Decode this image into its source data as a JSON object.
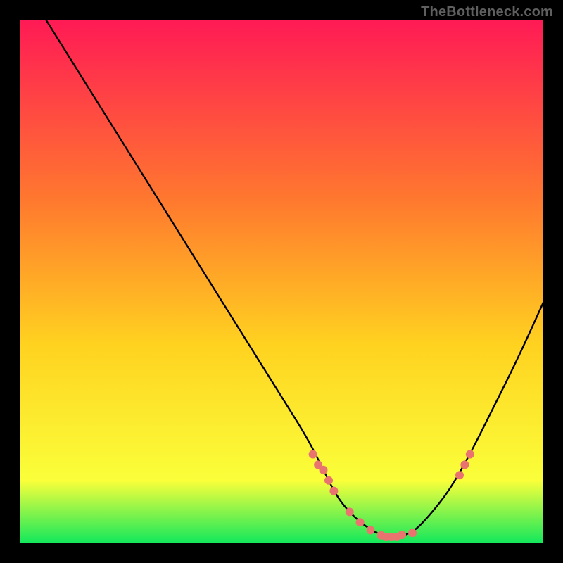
{
  "watermark": "TheBottleneck.com",
  "colors": {
    "gradient_top": "#ff1a55",
    "gradient_mid1": "#ff7a2e",
    "gradient_mid2": "#ffd220",
    "gradient_mid3": "#faff3a",
    "gradient_bottom": "#12e85c",
    "curve": "#000000",
    "marker": "#e9746f",
    "frame_bg": "#000000"
  },
  "chart_data": {
    "type": "line",
    "title": "",
    "xlabel": "",
    "ylabel": "",
    "xlim": [
      0,
      100
    ],
    "ylim": [
      0,
      100
    ],
    "legend": false,
    "grid": false,
    "curve": {
      "name": "bottleneck-curve",
      "x": [
        5,
        10,
        15,
        20,
        25,
        30,
        35,
        40,
        45,
        50,
        55,
        58,
        60,
        62,
        65,
        68,
        70,
        72,
        75,
        78,
        82,
        86,
        90,
        95,
        100
      ],
      "y": [
        100,
        92,
        84,
        76,
        68,
        60,
        52,
        44,
        36,
        28,
        20,
        14,
        10,
        7,
        4,
        2,
        1.2,
        1.2,
        2,
        5,
        10,
        17,
        25,
        35,
        46
      ]
    },
    "markers": {
      "name": "highlight-points",
      "x": [
        56,
        57,
        58,
        59,
        60,
        63,
        65,
        67,
        69,
        70,
        71,
        72,
        73,
        75,
        84,
        85,
        86
      ],
      "y": [
        17,
        15,
        14,
        12,
        10,
        6,
        4,
        2.5,
        1.5,
        1.2,
        1.2,
        1.2,
        1.6,
        2,
        13,
        15,
        17
      ]
    }
  }
}
